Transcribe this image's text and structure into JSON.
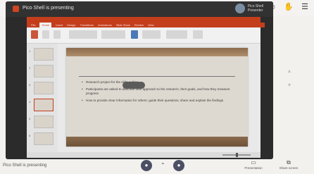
{
  "window": {
    "share_title": "Pico Shell is presenting",
    "presenter_name": "Pico Shell",
    "presenter_sub": "Presenter"
  },
  "meeting_icons": [
    "contact-icon",
    "hand-icon",
    "menu-icon"
  ],
  "ppt": {
    "tabs": [
      "File",
      "Home",
      "Insert",
      "Design",
      "Transitions",
      "Animations",
      "Slide Show",
      "Review",
      "View"
    ],
    "active_tab": "Home",
    "thumb_numbers": [
      "1",
      "2",
      "3",
      "4",
      "5",
      "6"
    ],
    "slide_bullets": [
      "Research project for the slide outline",
      "Participants are asked to describe their approach to the research, their goals, and how they measure progress",
      "How to provide clear information for others: guide their questions, share and explain the findings"
    ],
    "zoom_level": 0.5
  },
  "bottom_bar": {
    "status_text": "Pico Shell is presenting",
    "presentation_label": "Presentation",
    "share_label": "Share screen"
  },
  "colors": {
    "ppt_accent": "#c43e1c",
    "control_button": "#4a4f64"
  }
}
